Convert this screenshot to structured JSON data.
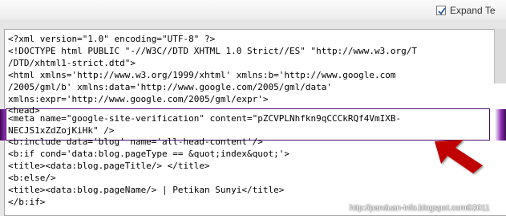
{
  "toolbar": {
    "expand_label": "Expand Te",
    "expand_checked": true
  },
  "code_lines": [
    "<?xml version=\"1.0\" encoding=\"UTF-8\" ?>",
    "<!DOCTYPE html PUBLIC \"-//W3C//DTD XHTML 1.0 Strict//ES\" \"http://www.w3.org/T",
    "/DTD/xhtml1-strict.dtd\">",
    "<html xmlns='http://www.w3.org/1999/xhtml' xmlns:b='http://www.google.com",
    "/2005/gml/b' xmlns:data='http://www.google.com/2005/gml/data'",
    "xmlns:expr='http://www.google.com/2005/gml/expr'>",
    "<head>",
    "<meta name=\"google-site-verification\" content=\"pZCVPLNhfkn9qCCCkRQf4VmIXB-",
    "NECJS1xZdZojKiHk\" />",
    "<b:include data='blog' name='all-head-content'/>",
    "<b:if cond='data:blog.pageType == &quot;index&quot;'>",
    "<title><data:blog.pageTitle/> </title>",
    "<b:else/>",
    "<title><data:blog.pageName/> | Petikan Sunyi</title>",
    "</b:if>"
  ],
  "watermark": "http://panduan-info.blogspot.com©2011",
  "colors": {
    "highlight_border": "#4b0f6b",
    "arrow": "#c00000"
  }
}
